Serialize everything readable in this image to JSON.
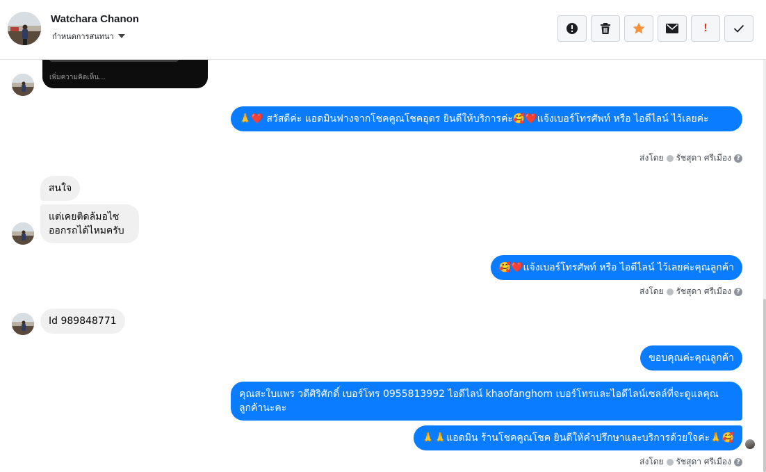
{
  "header": {
    "name": "Watchara Chanon",
    "subtitle": "กำหนดการสนทนา",
    "actions": [
      {
        "icon": "alert-circle-icon",
        "name": "mark-spam-button"
      },
      {
        "icon": "trash-icon",
        "name": "delete-button"
      },
      {
        "icon": "star-icon",
        "name": "star-button",
        "color": "#f7923b"
      },
      {
        "icon": "envelope-icon",
        "name": "mark-unread-button"
      },
      {
        "icon": "exclamation-icon",
        "name": "follow-up-button",
        "color": "#e0321e",
        "label": "!"
      },
      {
        "icon": "checkmark-icon",
        "name": "mark-done-button"
      }
    ]
  },
  "image_caption": "เพิ่มความคิดเห็น...",
  "messages": {
    "m1": "🙏❤️ สวัสดีค่ะ แอดมินฟางจากโชคคูณโชคอุดร ยินดีให้บริการค่ะ🥰❤️แจ้งเบอร์โทรศัพท์ หรือ ไอดีไลน์  ไว้เลยค่ะ",
    "m2": "สนใจ",
    "m3": "แต่เคยติดล้มอไซ ออกรถได้ไหมครับ",
    "m4": "🥰❤️แจ้งเบอร์โทรศัพท์ หรือ ไอดีไลน์  ไว้เลยค่ะคุณลูกค้า",
    "m5": "Id 989848771",
    "m6": "ขอบคุณค่ะคุณลูกค้า",
    "m7": "คุณสะใบแพร วดีศิริศักดิ์ เบอร์โทร 0955813992  ไอดีไลน์  khaofanghom   เบอร์โทรและไอดีไลน์เซลล์ที่จะดูแลคุณลูกค้านะคะ",
    "m8": "🙏🙏แอดมิน ร้านโชคคูณโชค ยินดีให้คำปรึกษาและบริการด้วยใจค่ะ🙏🥰"
  },
  "sent_by": {
    "prefix": "ส่งโดย",
    "agent": "รัชสุดา ศรีเมือง"
  },
  "colors": {
    "outgoing_bubble": "#0a7cff",
    "incoming_bubble": "#f0f0f0"
  }
}
